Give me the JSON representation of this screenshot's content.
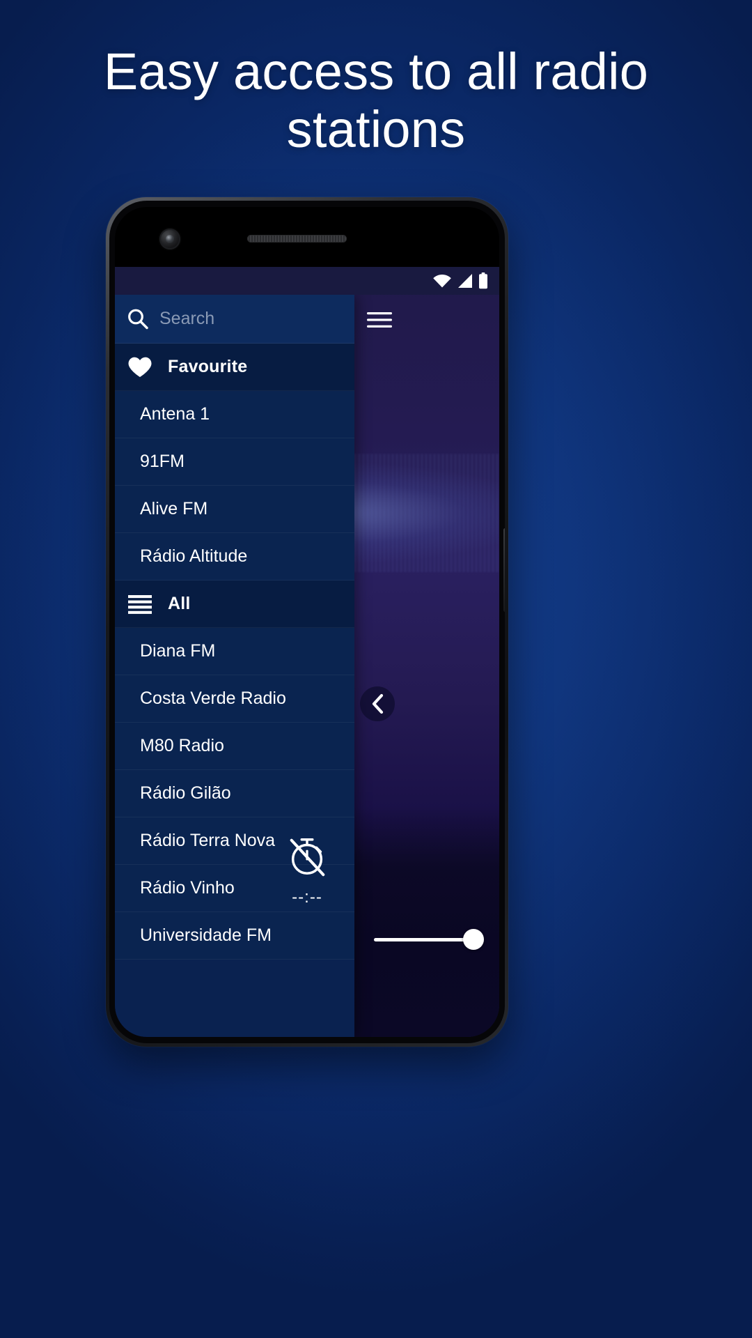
{
  "headline": "Easy access to all radio stations",
  "colors": {
    "page_bg": "#0b2c6b",
    "drawer_bg": "#0a2250",
    "station_bg": "#0a2450",
    "section_header_bg": "#071c42",
    "searchbar_bg": "#0d2b5e",
    "statusbar_bg": "#191a40",
    "accent_white": "#ffffff"
  },
  "statusbar": {
    "icons": [
      "wifi-icon",
      "cellular-signal-icon",
      "battery-icon"
    ]
  },
  "search": {
    "icon": "search-icon",
    "placeholder": "Search",
    "value": ""
  },
  "menu_button": {
    "icon": "hamburger-menu-icon"
  },
  "sections": [
    {
      "id": "favourite",
      "icon": "heart-icon",
      "label": "Favourite",
      "stations": [
        "Antena 1",
        "91FM",
        "Alive FM",
        "Rádio Altitude"
      ]
    },
    {
      "id": "all",
      "icon": "list-icon",
      "label": "All",
      "stations": [
        "Diana FM",
        "Costa Verde Radio",
        "M80 Radio",
        "Rádio Gilão",
        "Rádio Terra Nova",
        "Rádio Vinho",
        "Universidade FM"
      ]
    }
  ],
  "player": {
    "collapse_icon": "chevron-left-icon",
    "sleep_timer": {
      "icon": "timer-off-icon",
      "value": "--:--"
    },
    "volume": {
      "level_percent": 100
    }
  }
}
